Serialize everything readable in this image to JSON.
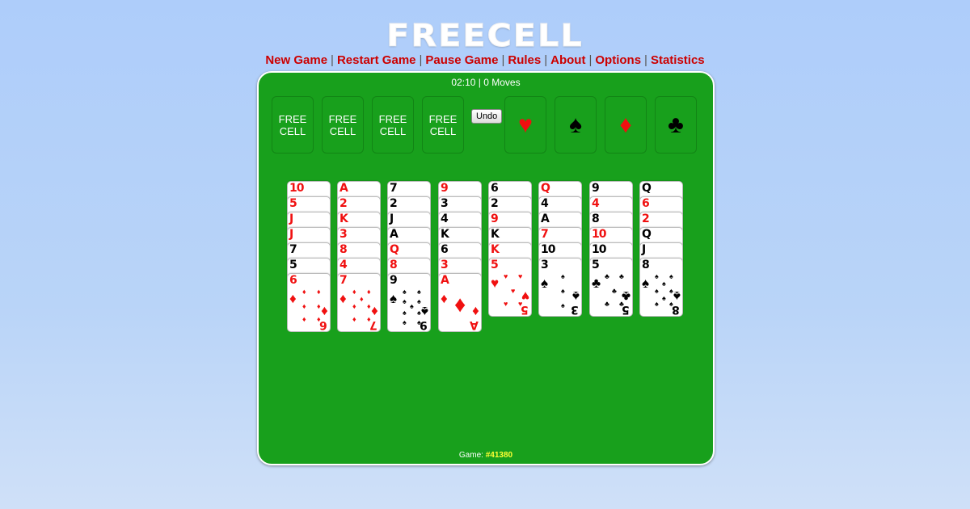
{
  "title": "FREECELL",
  "nav": [
    {
      "label": "New Game"
    },
    {
      "label": "Restart Game"
    },
    {
      "label": "Pause Game"
    },
    {
      "label": "Rules"
    },
    {
      "label": "About"
    },
    {
      "label": "Options"
    },
    {
      "label": "Statistics"
    }
  ],
  "nav_separator": "|",
  "status": {
    "time": "02:10",
    "moves": "0 Moves",
    "text": "02:10 | 0 Moves"
  },
  "free_cells": [
    {
      "label_line1": "FREE",
      "label_line2": "CELL"
    },
    {
      "label_line1": "FREE",
      "label_line2": "CELL"
    },
    {
      "label_line1": "FREE",
      "label_line2": "CELL"
    },
    {
      "label_line1": "FREE",
      "label_line2": "CELL"
    }
  ],
  "undo_label": "Undo",
  "foundations": [
    {
      "suit": "hearts",
      "glyph": "♥",
      "color": "red"
    },
    {
      "suit": "spades",
      "glyph": "♠",
      "color": "black"
    },
    {
      "suit": "diamonds",
      "glyph": "♦",
      "color": "red"
    },
    {
      "suit": "clubs",
      "glyph": "♣",
      "color": "black"
    }
  ],
  "tableau": [
    [
      {
        "rank": "10",
        "color": "red"
      },
      {
        "rank": "5",
        "color": "red"
      },
      {
        "rank": "J",
        "color": "red"
      },
      {
        "rank": "J",
        "color": "red"
      },
      {
        "rank": "7",
        "color": "black"
      },
      {
        "rank": "5",
        "color": "black"
      },
      {
        "rank": "6",
        "color": "red",
        "suit": "♦"
      }
    ],
    [
      {
        "rank": "A",
        "color": "red"
      },
      {
        "rank": "2",
        "color": "red"
      },
      {
        "rank": "K",
        "color": "red"
      },
      {
        "rank": "3",
        "color": "red"
      },
      {
        "rank": "8",
        "color": "red"
      },
      {
        "rank": "4",
        "color": "red"
      },
      {
        "rank": "7",
        "color": "red",
        "suit": "♦"
      }
    ],
    [
      {
        "rank": "7",
        "color": "black"
      },
      {
        "rank": "2",
        "color": "black"
      },
      {
        "rank": "J",
        "color": "black"
      },
      {
        "rank": "A",
        "color": "black"
      },
      {
        "rank": "Q",
        "color": "red"
      },
      {
        "rank": "8",
        "color": "red"
      },
      {
        "rank": "9",
        "color": "black",
        "suit": "♠"
      }
    ],
    [
      {
        "rank": "9",
        "color": "red"
      },
      {
        "rank": "3",
        "color": "black"
      },
      {
        "rank": "4",
        "color": "black"
      },
      {
        "rank": "K",
        "color": "black"
      },
      {
        "rank": "6",
        "color": "black"
      },
      {
        "rank": "3",
        "color": "red"
      },
      {
        "rank": "A",
        "color": "red",
        "suit": "♦"
      }
    ],
    [
      {
        "rank": "6",
        "color": "black"
      },
      {
        "rank": "2",
        "color": "black"
      },
      {
        "rank": "9",
        "color": "red"
      },
      {
        "rank": "K",
        "color": "black"
      },
      {
        "rank": "K",
        "color": "red"
      },
      {
        "rank": "5",
        "color": "red",
        "suit": "♥"
      }
    ],
    [
      {
        "rank": "Q",
        "color": "red"
      },
      {
        "rank": "4",
        "color": "black"
      },
      {
        "rank": "A",
        "color": "black"
      },
      {
        "rank": "7",
        "color": "red"
      },
      {
        "rank": "10",
        "color": "black"
      },
      {
        "rank": "3",
        "color": "black",
        "suit": "♠"
      }
    ],
    [
      {
        "rank": "9",
        "color": "black"
      },
      {
        "rank": "4",
        "color": "red"
      },
      {
        "rank": "8",
        "color": "black"
      },
      {
        "rank": "10",
        "color": "red"
      },
      {
        "rank": "10",
        "color": "black"
      },
      {
        "rank": "5",
        "color": "black",
        "suit": "♣"
      }
    ],
    [
      {
        "rank": "Q",
        "color": "black"
      },
      {
        "rank": "6",
        "color": "red"
      },
      {
        "rank": "2",
        "color": "red"
      },
      {
        "rank": "Q",
        "color": "black"
      },
      {
        "rank": "J",
        "color": "black"
      },
      {
        "rank": "8",
        "color": "black",
        "suit": "♠"
      }
    ]
  ],
  "footer": {
    "label": "Game:",
    "number": "#41380"
  },
  "colors": {
    "felt": "#18a01c",
    "nav_link": "#cc0000",
    "red_suit": "#f01010",
    "game_number": "#ffff33"
  }
}
